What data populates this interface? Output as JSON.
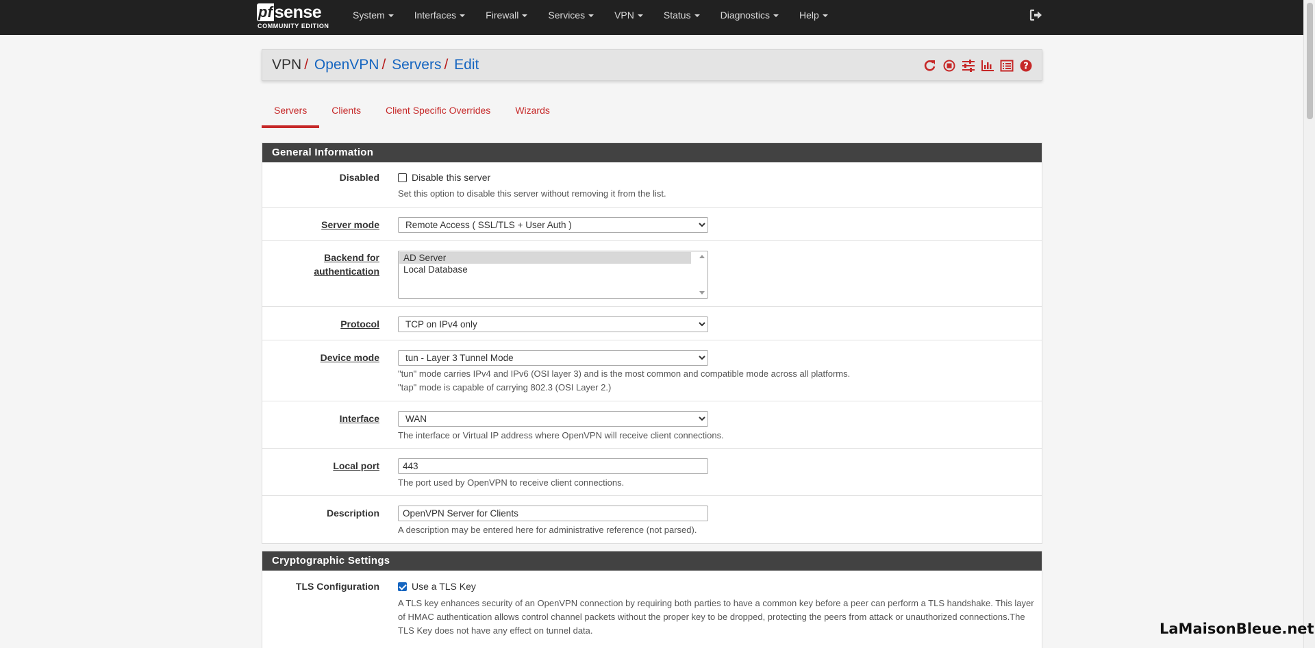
{
  "brand": {
    "logo_pf": "pf",
    "logo_sense": "sense",
    "edition": "COMMUNITY EDITION"
  },
  "nav": [
    {
      "label": "System"
    },
    {
      "label": "Interfaces"
    },
    {
      "label": "Firewall"
    },
    {
      "label": "Services"
    },
    {
      "label": "VPN"
    },
    {
      "label": "Status"
    },
    {
      "label": "Diagnostics"
    },
    {
      "label": "Help"
    }
  ],
  "breadcrumb": {
    "root": "VPN",
    "items": [
      "OpenVPN",
      "Servers",
      "Edit"
    ],
    "separator": "/"
  },
  "header_icons": [
    "restart-icon",
    "stop-icon",
    "settings-sliders-icon",
    "bar-chart-icon",
    "log-list-icon",
    "help-circle-icon"
  ],
  "tabs": [
    {
      "label": "Servers",
      "active": true
    },
    {
      "label": "Clients",
      "active": false
    },
    {
      "label": "Client Specific Overrides",
      "active": false
    },
    {
      "label": "Wizards",
      "active": false
    }
  ],
  "general": {
    "title": "General Information",
    "disabled": {
      "label": "Disabled",
      "checkbox_label": "Disable this server",
      "checked": false,
      "help": "Set this option to disable this server without removing it from the list."
    },
    "server_mode": {
      "label": "Server mode",
      "value": "Remote Access ( SSL/TLS + User Auth )"
    },
    "backend": {
      "label_line1": "Backend for",
      "label_line2": "authentication",
      "options": [
        "AD Server",
        "Local Database"
      ],
      "selected": "AD Server"
    },
    "protocol": {
      "label": "Protocol",
      "value": "TCP on IPv4 only"
    },
    "device_mode": {
      "label": "Device mode",
      "value": "tun - Layer 3 Tunnel Mode",
      "help1": "\"tun\" mode carries IPv4 and IPv6 (OSI layer 3) and is the most common and compatible mode across all platforms.",
      "help2": "\"tap\" mode is capable of carrying 802.3 (OSI Layer 2.)"
    },
    "interface": {
      "label": "Interface",
      "value": "WAN",
      "help": "The interface or Virtual IP address where OpenVPN will receive client connections."
    },
    "local_port": {
      "label": "Local port",
      "value": "443",
      "help": "The port used by OpenVPN to receive client connections."
    },
    "description": {
      "label": "Description",
      "value": "OpenVPN Server for Clients",
      "help": "A description may be entered here for administrative reference (not parsed)."
    }
  },
  "crypto": {
    "title": "Cryptographic Settings",
    "tls": {
      "label": "TLS Configuration",
      "checkbox_label": "Use a TLS Key",
      "checked": true,
      "help": "A TLS key enhances security of an OpenVPN connection by requiring both parties to have a common key before a peer can perform a TLS handshake. This layer of HMAC authentication allows control channel packets without the proper key to be dropped, protecting the peers from attack or unauthorized connections.The TLS Key does not have any effect on tunnel data."
    }
  },
  "watermark": "LaMaisonBleue.net",
  "colors": {
    "navbar": "#212121",
    "accent_red": "#c62828",
    "link_blue": "#1565c0",
    "panel_header": "#424242"
  }
}
